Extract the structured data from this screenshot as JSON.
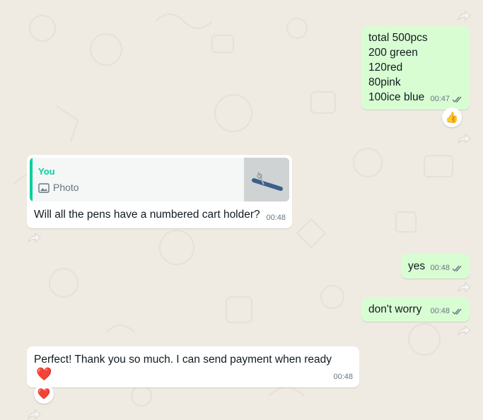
{
  "chat": {
    "messages": [
      {
        "direction": "outgoing",
        "lines": [
          "total 500pcs",
          "200 green",
          "120red",
          "80pink",
          "100ice blue"
        ],
        "time": "00:47",
        "status": "read",
        "reaction": "👍"
      },
      {
        "direction": "incoming",
        "quote": {
          "author": "You",
          "type_label": "Photo",
          "icon": "photo-icon"
        },
        "text": "Will all the pens have a numbered cart holder?",
        "time": "00:48"
      },
      {
        "direction": "outgoing",
        "text": "yes",
        "time": "00:48",
        "status": "read"
      },
      {
        "direction": "outgoing",
        "text": "don't worry",
        "time": "00:48",
        "status": "read"
      },
      {
        "direction": "incoming",
        "text": "Perfect! Thank you so much. I can send payment when ready",
        "emoji": "❤️",
        "time": "00:48",
        "reaction": "❤️"
      }
    ]
  },
  "colors": {
    "background": "#efeae2",
    "outgoing_bubble": "#d9fdd3",
    "incoming_bubble": "#ffffff",
    "quote_accent": "#06cf9c",
    "read_ticks": "#667781"
  }
}
